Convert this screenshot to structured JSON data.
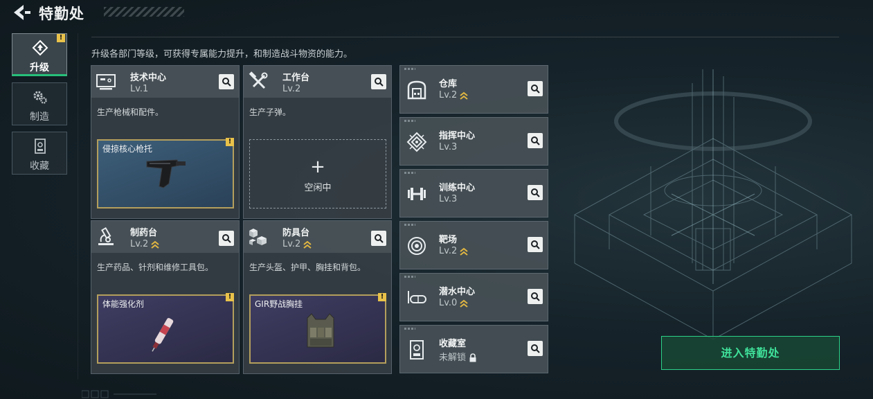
{
  "header": {
    "title": "特勤处"
  },
  "side_tabs": [
    {
      "label": "升级",
      "icon": "upgrade-icon",
      "active": true,
      "alert": "!"
    },
    {
      "label": "制造",
      "icon": "gears-icon",
      "active": false
    },
    {
      "label": "收藏",
      "icon": "collection-icon",
      "active": false
    }
  ],
  "description": "升级各部门等级，可获得专属能力提升，和制造战斗物资的能力。",
  "cards": [
    {
      "name": "技术中心",
      "level": "Lv.1",
      "icon": "monitor-icon",
      "desc": "生产枪械和配件。",
      "slot_name": "侵掠核心枪托",
      "slot_alert": "!"
    },
    {
      "name": "工作台",
      "level": "Lv.2",
      "icon": "hammer-wrench-icon",
      "desc": "生产子弹。",
      "empty_plus": "+",
      "empty_label": "空闲中"
    },
    {
      "name": "制药台",
      "level": "Lv.2",
      "icon": "microscope-icon",
      "desc": "生产药品、针剂和维修工具包。",
      "slot_name": "体能强化剂",
      "slot_alert": "!"
    },
    {
      "name": "防具台",
      "level": "Lv.2",
      "icon": "blocks-icon",
      "desc": "生产头盔、护甲、胸挂和背包。",
      "slot_name": "GIR野战胸挂",
      "slot_alert": "!"
    }
  ],
  "departments": [
    {
      "name": "仓库",
      "level": "Lv.2",
      "icon": "warehouse-icon",
      "upgrade": true
    },
    {
      "name": "指挥中心",
      "level": "Lv.3",
      "icon": "chip-icon",
      "upgrade": false
    },
    {
      "name": "训练中心",
      "level": "Lv.3",
      "icon": "dumbbell-icon",
      "upgrade": false
    },
    {
      "name": "靶场",
      "level": "Lv.2",
      "icon": "target-icon",
      "upgrade": true
    },
    {
      "name": "潜水中心",
      "level": "Lv.0",
      "icon": "diving-mask-icon",
      "upgrade": true
    },
    {
      "name": "收藏室",
      "level": "未解锁",
      "icon": "display-case-icon",
      "locked": true
    }
  ],
  "enter_button": "进入特勤处",
  "colors": {
    "accent_green": "#2bd38a",
    "alert_yellow": "#e9c24a",
    "upgrade_gold": "#e2b742"
  }
}
